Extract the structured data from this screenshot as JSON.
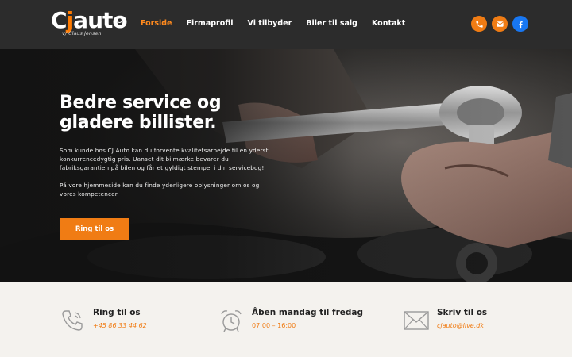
{
  "brand": {
    "logo_c": "C",
    "logo_j": "j",
    "logo_rest": "auto",
    "tagline": "v/ Claus Jensen"
  },
  "nav": {
    "items": [
      {
        "label": "Forside",
        "active": true
      },
      {
        "label": "Firmaprofil",
        "active": false
      },
      {
        "label": "Vi tilbyder",
        "active": false
      },
      {
        "label": "Biler til salg",
        "active": false
      },
      {
        "label": "Kontakt",
        "active": false
      }
    ]
  },
  "socials": [
    {
      "icon": "phone-icon",
      "color": "#f07c14"
    },
    {
      "icon": "mail-icon",
      "color": "#f07c14"
    },
    {
      "icon": "facebook-icon",
      "color": "#1877f2"
    }
  ],
  "hero": {
    "title": "Bedre service og gladere billister.",
    "paragraph1": "Som kunde hos CJ Auto kan du forvente kvalitetsarbejde til en yderst konkurrencedygtig pris. Uanset dit bilmærke bevarer du fabriksgarantien på bilen og får et gyldigt stempel i din servicebog!",
    "paragraph2": "På vore hjemmeside kan du finde yderligere oplysninger om os og vores kompetencer.",
    "cta_label": "Ring til os"
  },
  "info": {
    "phone": {
      "title": "Ring til os",
      "value": "+45 86 33 44 62",
      "icon": "phone-outline-icon"
    },
    "hours": {
      "title": "Åben mandag til fredag",
      "value": "07:00 – 16:00",
      "icon": "alarm-clock-icon"
    },
    "mail": {
      "title": "Skriv til os",
      "value": "cjauto@live.dk",
      "icon": "envelope-icon"
    }
  },
  "colors": {
    "accent": "#f07c14",
    "header_bg": "#2c2c2c",
    "facebook": "#1877f2",
    "info_bg": "#f4f2ee"
  }
}
